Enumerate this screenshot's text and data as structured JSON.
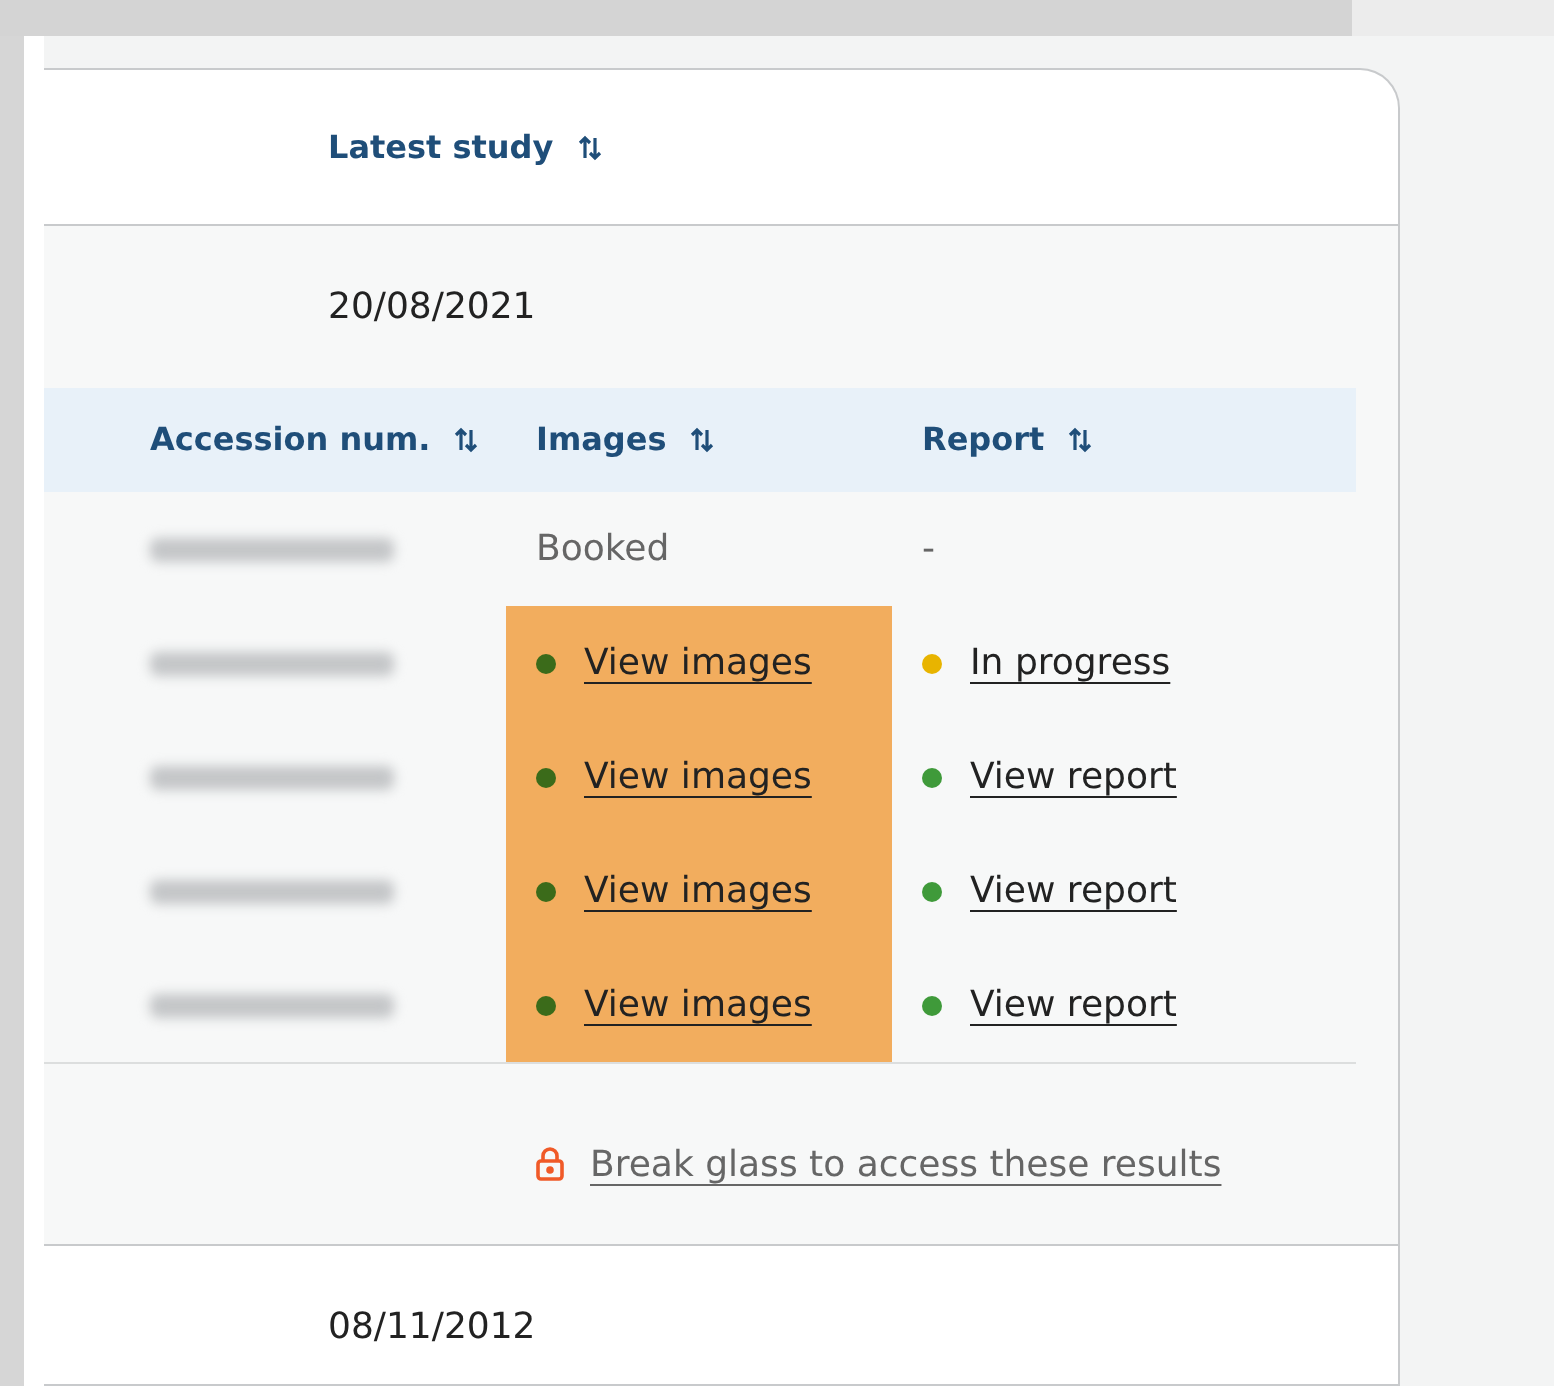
{
  "table": {
    "columns": [
      {
        "label": "Latest study",
        "sortable": true
      }
    ],
    "rows": [
      {
        "latest_study": "20/08/2021",
        "studies": {
          "columns": [
            {
              "label": "Accession num.",
              "sortable": true
            },
            {
              "label": "Images",
              "sortable": true
            },
            {
              "label": "Report",
              "sortable": true
            }
          ],
          "rows": [
            {
              "images": {
                "kind": "text",
                "text": "Booked",
                "highlighted": false
              },
              "report": {
                "kind": "text",
                "text": "-"
              }
            },
            {
              "images": {
                "kind": "link",
                "text": "View images",
                "color": "#3b6b1a",
                "highlighted": true
              },
              "report": {
                "kind": "link",
                "text": "In progress",
                "color": "#e8b400"
              }
            },
            {
              "images": {
                "kind": "link",
                "text": "View images",
                "color": "#3b6b1a",
                "highlighted": true
              },
              "report": {
                "kind": "link",
                "text": "View report",
                "color": "#3f9a3a"
              }
            },
            {
              "images": {
                "kind": "link",
                "text": "View images",
                "color": "#3b6b1a",
                "highlighted": true
              },
              "report": {
                "kind": "link",
                "text": "View report",
                "color": "#3f9a3a"
              }
            },
            {
              "images": {
                "kind": "link",
                "text": "View images",
                "color": "#3b6b1a",
                "highlighted": true
              },
              "report": {
                "kind": "link",
                "text": "View report",
                "color": "#3f9a3a"
              }
            }
          ],
          "break_glass": "Break glass to access these results"
        }
      },
      {
        "latest_study": "08/11/2012"
      }
    ]
  }
}
